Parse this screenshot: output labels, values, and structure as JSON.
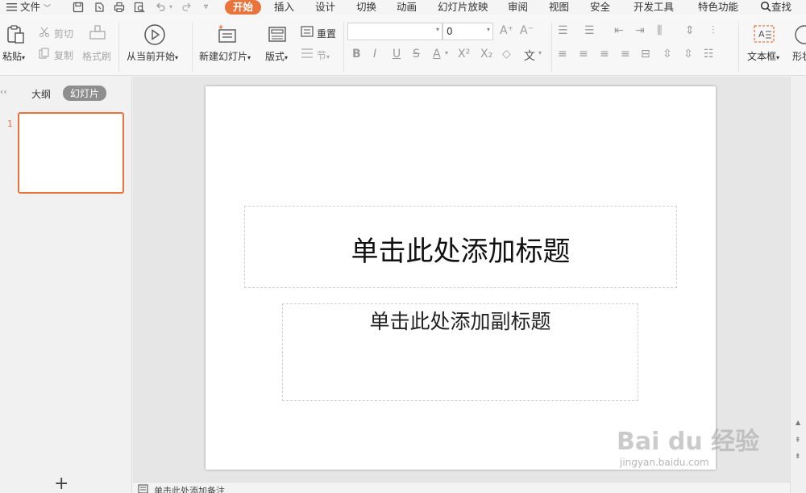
{
  "menu": {
    "file": "文件",
    "tabs": [
      "开始",
      "插入",
      "设计",
      "切换",
      "动画",
      "幻灯片放映",
      "审阅",
      "视图",
      "安全",
      "开发工具",
      "特色功能"
    ],
    "search": "查找"
  },
  "ribbon": {
    "paste": "粘贴",
    "cut": "剪切",
    "copy": "复制",
    "format_painter": "格式刷",
    "from_current": "从当前开始",
    "new_slide": "新建幻灯片",
    "layout": "版式",
    "reset": "重置",
    "section": "节",
    "font_size": "0",
    "text_box": "文本框",
    "shape": "形状"
  },
  "left_pane": {
    "tab_outline": "大纲",
    "tab_slides": "幻灯片",
    "slide_number": "1",
    "add_button": "+"
  },
  "slide": {
    "title_placeholder": "单击此处添加标题",
    "subtitle_placeholder": "单击此处添加副标题"
  },
  "notes": {
    "placeholder": "单击此处添加备注"
  },
  "watermark": {
    "brand": "Bai du 经验",
    "url": "jingyan.baidu.com"
  },
  "colors": {
    "accent": "#e8743b",
    "thumb_border": "#e8743b"
  }
}
